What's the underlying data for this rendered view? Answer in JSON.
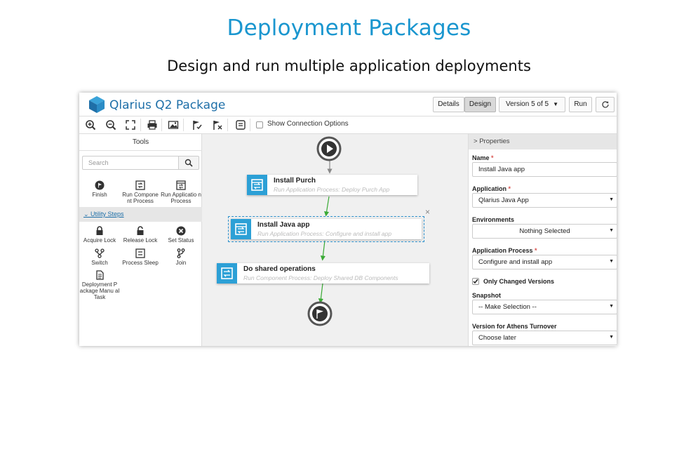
{
  "slide": {
    "title": "Deployment Packages",
    "subtitle": "Design and run multiple application deployments"
  },
  "app": {
    "title": "Qlarius Q2 Package",
    "accent": "#2ca0d6",
    "buttons": {
      "details": "Details",
      "design": "Design",
      "version": "Version 5 of 5",
      "run": "Run"
    }
  },
  "toolbar": {
    "icons": [
      "zoom-in-icon",
      "zoom-out-icon",
      "fit-to-screen-icon",
      "print-icon",
      "image-export-icon",
      "flag-check-icon",
      "flag-remove-icon",
      "note-icon"
    ],
    "show_connection_label": "Show Connection Options"
  },
  "tools": {
    "title": "Tools",
    "search_placeholder": "Search",
    "items": [
      "Finish",
      "Run Compone nt Process",
      "Run Applicatio n Process"
    ],
    "section_label": "Utility Steps",
    "utility_items": [
      "Acquire Lock",
      "Release Lock",
      "Set Status",
      "Switch",
      "Process Sleep",
      "Join",
      "Deployment P ackage Manu al Task"
    ]
  },
  "canvas": {
    "nodes": [
      {
        "title": "Install Purch",
        "subtitle": "Run Application Process: Deploy Purch App"
      },
      {
        "title": "Install Java app",
        "subtitle": "Run Application Process: Configure and install app"
      },
      {
        "title": "Do shared operations",
        "subtitle": "Run Component Process: Deploy Shared DB Components"
      }
    ],
    "close_glyph": "×"
  },
  "properties": {
    "header": "Properties",
    "name_label": "Name",
    "name_value": "Install Java app",
    "application_label": "Application",
    "application_value": "Qlarius Java App",
    "environments_label": "Environments",
    "environments_value": "Nothing Selected",
    "process_label": "Application Process",
    "process_value": "Configure and install app",
    "only_changed_label": "Only Changed Versions",
    "snapshot_label": "Snapshot",
    "snapshot_value": "-- Make Selection --",
    "athens_label": "Version for Athens Turnover",
    "athens_value": "Choose later",
    "required_mark": "*"
  }
}
